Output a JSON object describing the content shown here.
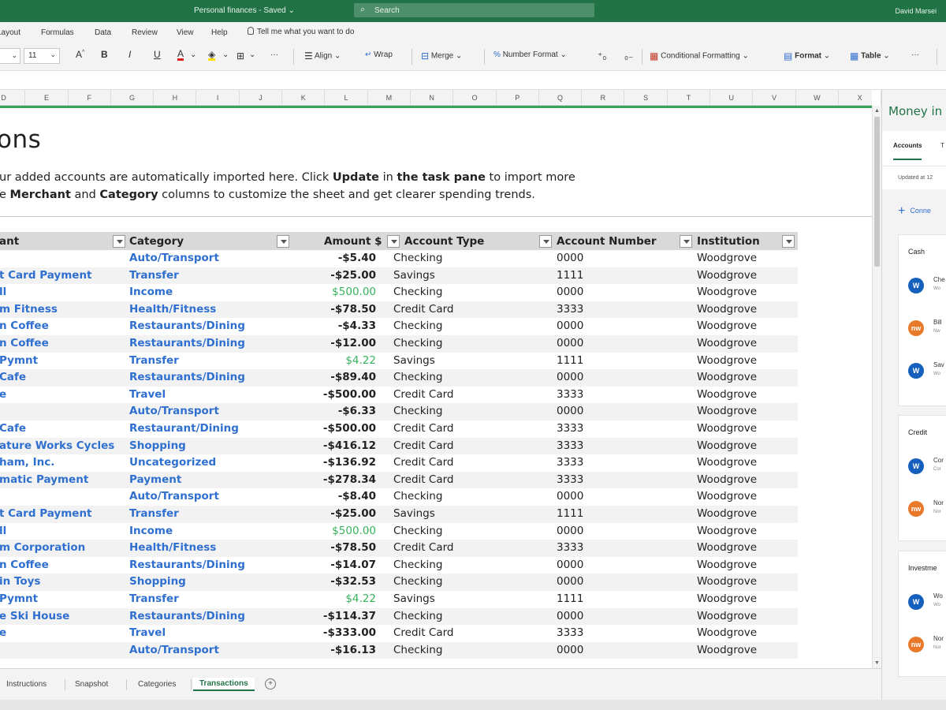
{
  "titlebar": {
    "document": "Personal finances - Saved",
    "saved_chevron": "⌄",
    "search_placeholder": "Search",
    "user": "David Marsei"
  },
  "menu": {
    "items": [
      "Layout",
      "Formulas",
      "Data",
      "Review",
      "View",
      "Help"
    ],
    "tell_me": "Tell me what you want to do"
  },
  "ribbon": {
    "font_size": "11",
    "increase_font": "A",
    "bold": "B",
    "italic": "I",
    "underline": "U",
    "font_color_letter": "A",
    "more": "···",
    "align": "Align",
    "wrap": "Wrap",
    "merge": "Merge",
    "number_format": "Number Format",
    "conditional_formatting": "Conditional Formatting",
    "format": "Format",
    "table": "Table"
  },
  "columns": [
    "D",
    "E",
    "F",
    "G",
    "H",
    "I",
    "J",
    "K",
    "L",
    "M",
    "N",
    "O",
    "P",
    "Q",
    "R",
    "S",
    "T",
    "U",
    "V",
    "W",
    "X"
  ],
  "sheet": {
    "title": "ons",
    "desc_line1_a": "ur added accounts are automatically imported here. Click ",
    "desc_line1_b": "Update",
    "desc_line1_c": " in ",
    "desc_line1_d": "the task pane",
    "desc_line1_e": " to import more",
    "desc_line2_a": "e ",
    "desc_line2_b": "Merchant",
    "desc_line2_c": " and ",
    "desc_line2_d": "Category",
    "desc_line2_e": " columns to customize the sheet and get clearer spending trends."
  },
  "table": {
    "headers": {
      "merchant": "ant",
      "category": "Category",
      "amount": "Amount $",
      "account_type": "Account Type",
      "account_number": "Account Number",
      "institution": "Institution"
    },
    "rows": [
      {
        "merchant": "",
        "category": "Auto/Transport",
        "amount": "-$5.40",
        "positive": false,
        "account_type": "Checking",
        "account_number": "0000",
        "institution": "Woodgrove"
      },
      {
        "merchant": "t Card Payment",
        "category": "Transfer",
        "amount": "-$25.00",
        "positive": false,
        "account_type": "Savings",
        "account_number": "1111",
        "institution": "Woodgrove"
      },
      {
        "merchant": "ll",
        "category": "Income",
        "amount": "$500.00",
        "positive": true,
        "account_type": "Checking",
        "account_number": "0000",
        "institution": "Woodgrove"
      },
      {
        "merchant": "m Fitness",
        "category": "Health/Fitness",
        "amount": "-$78.50",
        "positive": false,
        "account_type": "Credit Card",
        "account_number": "3333",
        "institution": "Woodgrove"
      },
      {
        "merchant": "n Coffee",
        "category": "Restaurants/Dining",
        "amount": "-$4.33",
        "positive": false,
        "account_type": "Checking",
        "account_number": "0000",
        "institution": "Woodgrove"
      },
      {
        "merchant": "n Coffee",
        "category": "Restaurants/Dining",
        "amount": "-$12.00",
        "positive": false,
        "account_type": "Checking",
        "account_number": "0000",
        "institution": "Woodgrove"
      },
      {
        "merchant": "Pymnt",
        "category": "Transfer",
        "amount": "$4.22",
        "positive": true,
        "account_type": "Savings",
        "account_number": "1111",
        "institution": "Woodgrove"
      },
      {
        "merchant": "Cafe",
        "category": "Restaurants/Dining",
        "amount": "-$89.40",
        "positive": false,
        "account_type": "Checking",
        "account_number": "0000",
        "institution": "Woodgrove"
      },
      {
        "merchant": "e",
        "category": "Travel",
        "amount": "-$500.00",
        "positive": false,
        "account_type": "Credit Card",
        "account_number": "3333",
        "institution": "Woodgrove"
      },
      {
        "merchant": "",
        "category": "Auto/Transport",
        "amount": "-$6.33",
        "positive": false,
        "account_type": "Checking",
        "account_number": "0000",
        "institution": "Woodgrove"
      },
      {
        "merchant": "Cafe",
        "category": "Restaurant/Dining",
        "amount": "-$500.00",
        "positive": false,
        "account_type": "Credit Card",
        "account_number": "3333",
        "institution": "Woodgrove"
      },
      {
        "merchant": "ature Works Cycles",
        "category": "Shopping",
        "amount": "-$416.12",
        "positive": false,
        "account_type": "Credit Card",
        "account_number": "3333",
        "institution": "Woodgrove"
      },
      {
        "merchant": "ham, Inc.",
        "category": "Uncategorized",
        "amount": "-$136.92",
        "positive": false,
        "account_type": "Credit Card",
        "account_number": "3333",
        "institution": "Woodgrove"
      },
      {
        "merchant": "matic Payment",
        "category": "Payment",
        "amount": "-$278.34",
        "positive": false,
        "account_type": "Credit Card",
        "account_number": "3333",
        "institution": "Woodgrove"
      },
      {
        "merchant": "",
        "category": "Auto/Transport",
        "amount": "-$8.40",
        "positive": false,
        "account_type": "Checking",
        "account_number": "0000",
        "institution": "Woodgrove"
      },
      {
        "merchant": "t Card Payment",
        "category": "Transfer",
        "amount": "-$25.00",
        "positive": false,
        "account_type": "Savings",
        "account_number": "1111",
        "institution": "Woodgrove"
      },
      {
        "merchant": "ll",
        "category": "Income",
        "amount": "$500.00",
        "positive": true,
        "account_type": "Checking",
        "account_number": "0000",
        "institution": "Woodgrove"
      },
      {
        "merchant": "m Corporation",
        "category": "Health/Fitness",
        "amount": "-$78.50",
        "positive": false,
        "account_type": "Credit Card",
        "account_number": "3333",
        "institution": "Woodgrove"
      },
      {
        "merchant": "n Coffee",
        "category": "Restaurants/Dining",
        "amount": "-$14.07",
        "positive": false,
        "account_type": "Checking",
        "account_number": "0000",
        "institution": "Woodgrove"
      },
      {
        "merchant": "in Toys",
        "category": "Shopping",
        "amount": "-$32.53",
        "positive": false,
        "account_type": "Checking",
        "account_number": "0000",
        "institution": "Woodgrove"
      },
      {
        "merchant": "Pymnt",
        "category": "Transfer",
        "amount": "$4.22",
        "positive": true,
        "account_type": "Savings",
        "account_number": "1111",
        "institution": "Woodgrove"
      },
      {
        "merchant": "e Ski House",
        "category": "Restaurants/Dining",
        "amount": "-$114.37",
        "positive": false,
        "account_type": "Checking",
        "account_number": "0000",
        "institution": "Woodgrove"
      },
      {
        "merchant": "e",
        "category": "Travel",
        "amount": "-$333.00",
        "positive": false,
        "account_type": "Credit Card",
        "account_number": "3333",
        "institution": "Woodgrove"
      },
      {
        "merchant": "",
        "category": "Auto/Transport",
        "amount": "-$16.13",
        "positive": false,
        "account_type": "Checking",
        "account_number": "0000",
        "institution": "Woodgrove"
      }
    ]
  },
  "sheet_tabs": [
    "Instructions",
    "Snapshot",
    "Categories",
    "Transactions"
  ],
  "active_tab": "Transactions",
  "add_sheet": "+",
  "task_pane": {
    "title": "Money in",
    "tabs": [
      "Accounts",
      "T"
    ],
    "updated": "Updated at 12",
    "connect": "Conne",
    "cards": [
      {
        "title": "Cash",
        "accounts": [
          {
            "logo": "W",
            "color": "blue",
            "name": "Che",
            "sub": "Wo"
          },
          {
            "logo": "nw",
            "color": "orange",
            "name": "Bill",
            "sub": "Nw"
          },
          {
            "logo": "W",
            "color": "blue",
            "name": "Sav",
            "sub": "Wo"
          }
        ]
      },
      {
        "title": "Credit",
        "accounts": [
          {
            "logo": "W",
            "color": "blue",
            "name": "Cor",
            "sub": "Cor"
          },
          {
            "logo": "nw",
            "color": "orange",
            "name": "Nor",
            "sub": "Nor"
          }
        ]
      },
      {
        "title": "Investme",
        "accounts": [
          {
            "logo": "W",
            "color": "blue",
            "name": "Wo",
            "sub": "Wo"
          },
          {
            "logo": "nw",
            "color": "orange",
            "name": "Nor",
            "sub": "Nor"
          }
        ]
      }
    ]
  }
}
